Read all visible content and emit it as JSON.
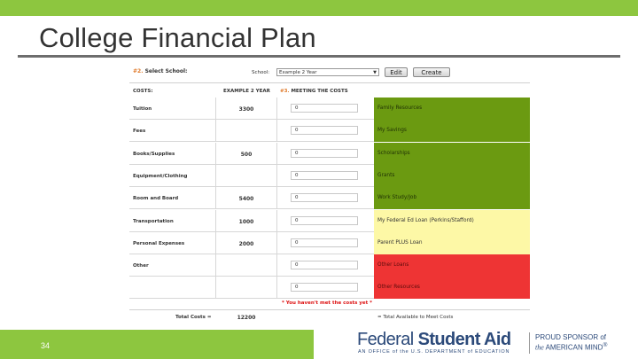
{
  "slide": {
    "title": "College Financial Plan",
    "page_number": "34"
  },
  "calculator": {
    "step_number": "#2.",
    "select_school_label": "Select School:",
    "school_field_label": "School:",
    "school_selected": "Example 2 Year",
    "edit_button": "Edit",
    "create_button": "Create",
    "headers": {
      "costs": "COSTS:",
      "school": "EXAMPLE 2 YEAR",
      "meeting_step": "#3.",
      "meeting": "MEETING THE COSTS"
    },
    "rows": [
      {
        "cost": "Tuition",
        "value": "3300",
        "input": "0",
        "resource": "Family Resources",
        "color": "green"
      },
      {
        "cost": "Fees",
        "value": "",
        "input": "0",
        "resource": "My Savings",
        "color": "green"
      },
      {
        "cost": "Books/Supplies",
        "value": "500",
        "input": "0",
        "resource": "Scholarships",
        "color": "green"
      },
      {
        "cost": "Equipment/Clothing",
        "value": "",
        "input": "0",
        "resource": "Grants",
        "color": "green"
      },
      {
        "cost": "Room and Board",
        "value": "5400",
        "input": "0",
        "resource": "Work Study/Job",
        "color": "green"
      },
      {
        "cost": "Transportation",
        "value": "1000",
        "input": "0",
        "resource": "My Federal Ed Loan (Perkins/Stafford)",
        "color": "yellow"
      },
      {
        "cost": "Personal Expenses",
        "value": "2000",
        "input": "0",
        "resource": "Parent PLUS Loan",
        "color": "yellow"
      },
      {
        "cost": "Other",
        "value": "",
        "input": "0",
        "resource": "Other Loans",
        "color": "red"
      },
      {
        "cost": "",
        "value": "",
        "input": "0",
        "resource": "Other Resources",
        "color": "red"
      }
    ],
    "warning": "* You haven't met the costs yet *",
    "total_label": "Total Costs =",
    "total_value": "12200",
    "total_meet_label": "= Total Available to Meet Costs"
  },
  "colors": {
    "accent_green": "#8dc63f",
    "resource_green": "#6b9a11",
    "resource_yellow": "#fdf8a6",
    "resource_red": "#ee3434"
  },
  "footer": {
    "logo_word1": "Federal ",
    "logo_word2": "Student Aid",
    "logo_sub": "AN OFFICE of the U.S. DEPARTMENT of EDUCATION",
    "sponsor_line1": "PROUD SPONSOR of",
    "sponsor_line2_prefix": "the",
    "sponsor_line2": "AMERICAN MIND",
    "sponsor_mark": "®"
  }
}
